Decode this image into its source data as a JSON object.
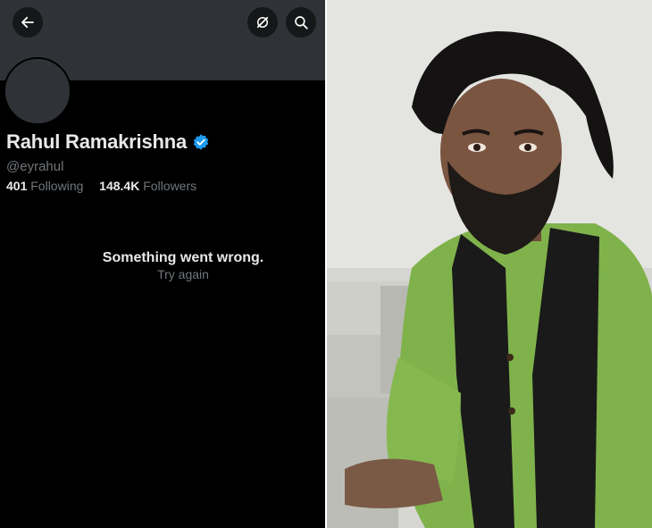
{
  "profile": {
    "name": "Rahul Ramakrishna",
    "handle": "@eyrahul",
    "following_count": "401",
    "following_label": "Following",
    "followers_count": "148.4K",
    "followers_label": "Followers",
    "verified_icon": "verified-badge-icon"
  },
  "error": {
    "message": "Something went wrong.",
    "retry_label": "Try again"
  },
  "icons": {
    "back": "back-arrow-icon",
    "grok": "grok-icon",
    "search": "search-icon"
  },
  "colors": {
    "background": "#000000",
    "banner": "#2f3337",
    "primary_text": "#e7e9ea",
    "secondary_text": "#71767b",
    "verified_blue": "#1d9bf0"
  }
}
